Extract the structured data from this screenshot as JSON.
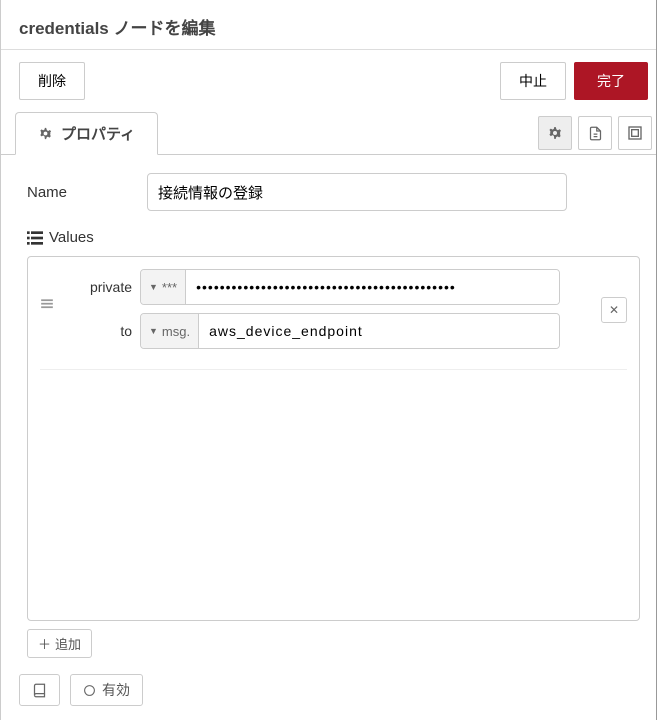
{
  "header": {
    "title": "credentials ノードを編集"
  },
  "toolbar": {
    "delete_label": "削除",
    "cancel_label": "中止",
    "done_label": "完了"
  },
  "tab": {
    "label": "プロパティ"
  },
  "form": {
    "name_label": "Name",
    "name_value": "接続情報の登録",
    "values_label": "Values"
  },
  "rules": [
    {
      "field_label": "private",
      "field_type": "***",
      "field_value": "••••••••••••••••••••••••••••••••••••••••••••",
      "to_label": "to",
      "to_type": "msg.",
      "to_value": "aws_device_endpoint"
    }
  ],
  "add_label": "追加",
  "footer": {
    "enabled_label": "有効"
  }
}
